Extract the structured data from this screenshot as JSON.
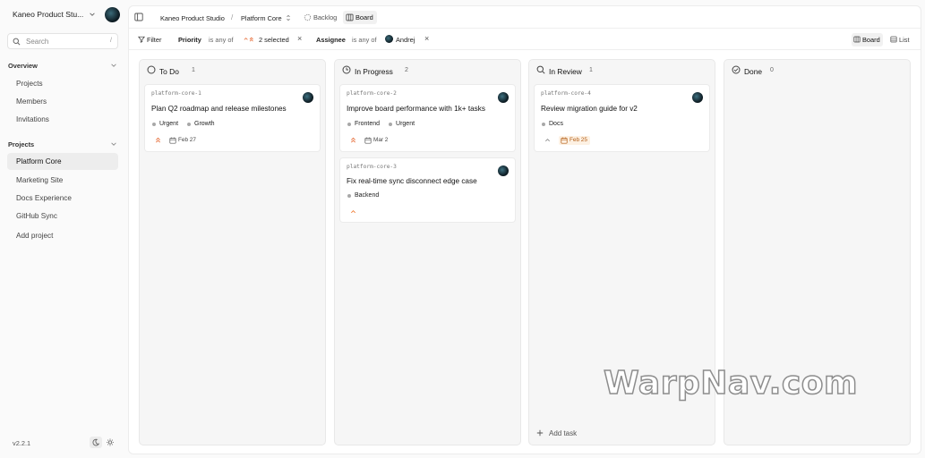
{
  "workspace": {
    "name": "Kaneo Product Stu..."
  },
  "search": {
    "placeholder": "Search",
    "shortcut": "/"
  },
  "sidebar": {
    "overview_label": "Overview",
    "overview_items": [
      "Projects",
      "Members",
      "Invitations"
    ],
    "projects_label": "Projects",
    "project_items": [
      "Platform Core",
      "Marketing Site",
      "Docs Experience",
      "GitHub Sync"
    ],
    "add_project_label": "Add project",
    "version": "v2.2.1"
  },
  "breadcrumb": {
    "workspace": "Kaneo Product Studio",
    "separator": "/",
    "project": "Platform Core"
  },
  "tabs": {
    "backlog": "Backlog",
    "board": "Board"
  },
  "filters": {
    "filter_label": "Filter",
    "priority_key": "Priority",
    "priority_op": "is any of",
    "priority_value": "2 selected",
    "assignee_key": "Assignee",
    "assignee_op": "is any of",
    "assignee_value": "Andrej",
    "remove_glyph": "×"
  },
  "views": {
    "board": "Board",
    "list": "List"
  },
  "columns": [
    {
      "title": "To Do",
      "count": "1",
      "icon": "circle-icon"
    },
    {
      "title": "In Progress",
      "count": "2",
      "icon": "in-progress-icon"
    },
    {
      "title": "In Review",
      "count": "1",
      "icon": "search-icon"
    },
    {
      "title": "Done",
      "count": "0",
      "icon": "check-circle-icon"
    }
  ],
  "cards": {
    "c1": {
      "id": "platform-core-1",
      "title": "Plan Q2 roadmap and release milestones",
      "labels": [
        "Urgent",
        "Growth"
      ],
      "priority": "urgent",
      "date": "Feb 27"
    },
    "c2": {
      "id": "platform-core-2",
      "title": "Improve board performance with 1k+ tasks",
      "labels": [
        "Frontend",
        "Urgent"
      ],
      "priority": "urgent",
      "date": "Mar 2"
    },
    "c3": {
      "id": "platform-core-3",
      "title": "Fix real-time sync disconnect edge case",
      "labels": [
        "Backend"
      ],
      "priority": "high"
    },
    "c4": {
      "id": "platform-core-4",
      "title": "Review migration guide for v2",
      "labels": [
        "Docs"
      ],
      "priority": "low",
      "date": "Feb 25"
    }
  },
  "add_task_label": "Add task",
  "watermark": "WarpNav.com",
  "colors": {
    "priority_urgent": "#e5652e",
    "priority_high": "#f07a2f",
    "due_bg": "#fdf1e3"
  }
}
